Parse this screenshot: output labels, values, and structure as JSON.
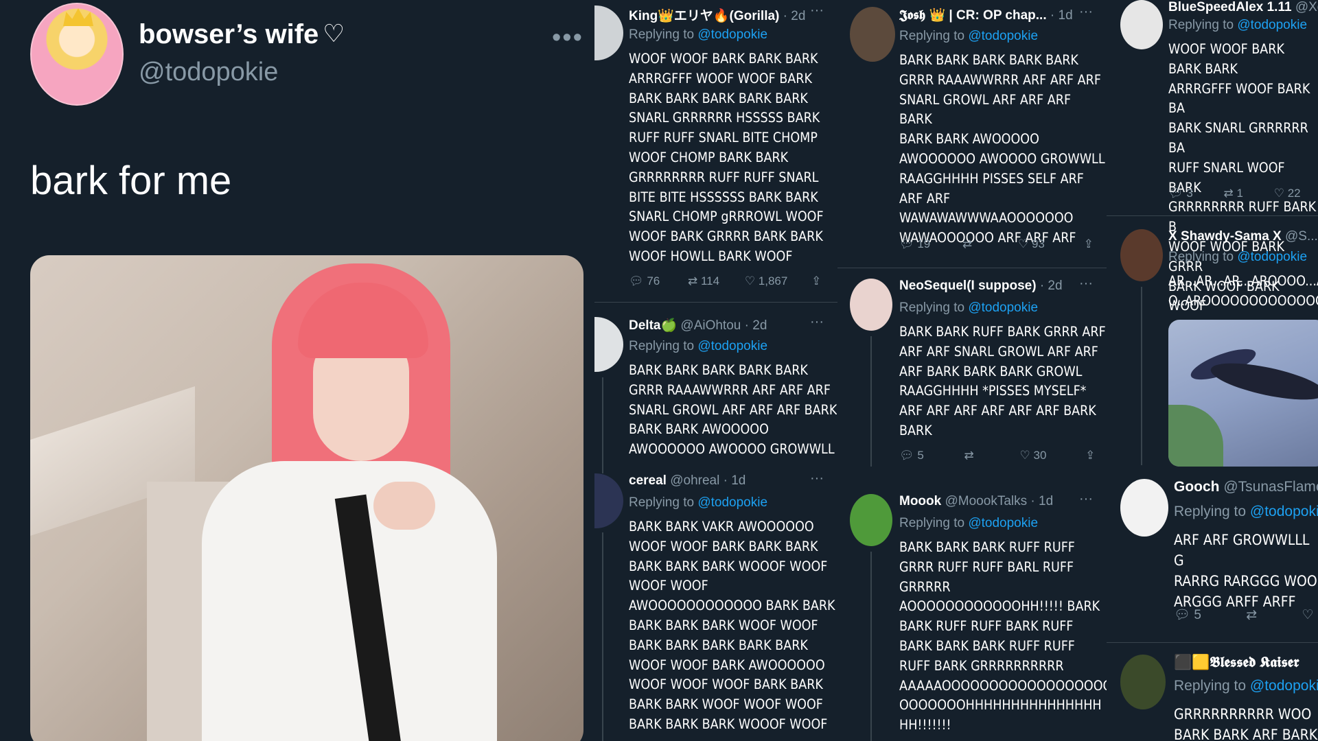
{
  "main": {
    "display_name": "bowser’s wife",
    "heart": "♡",
    "handle": "@todopokie",
    "more": "•••",
    "text": "bark for me"
  },
  "col1": {
    "r1": {
      "name": "King👑エリヤ🔥(Gorilla)",
      "handle": "",
      "time": "· 2d",
      "replying": "Replying to ",
      "mention": "@todopokie",
      "body": "WOOF WOOF BARK BARK BARK\nARRRGFFF WOOF WOOF BARK\nBARK BARK BARK BARK BARK\nSNARL GRRRRRR HSSSSS BARK\nRUFF RUFF SNARL BITE CHOMP\nWOOF CHOMP BARK BARK\nGRRRRRRRR RUFF RUFF SNARL\nBITE BITE HSSSSSS BARK BARK\nSNARL CHOMP gRRROWL WOOF\nWOOF BARK GRRRR BARK BARK\nWOOF HOWLL BARK WOOF",
      "replies": "76",
      "retweets": "114",
      "likes": "1,867"
    },
    "r2": {
      "name": "Delta🍏",
      "handle": "@AiOhtou",
      "time": "· 2d",
      "replying": "Replying to ",
      "mention": "@todopokie",
      "body": "BARK BARK BARK BARK BARK\nGRRR RAAAWWRRR ARF ARF ARF\nSNARL GROWL ARF ARF ARF BARK\nBARK BARK AWOOOOO\nAWOOOOOO AWOOOO GROWWLL\nRAAGGHHHH PISSES SELF ARF"
    },
    "r3": {
      "name": "cereal",
      "handle": "@ohreal",
      "time": "· 1d",
      "replying": "Replying to ",
      "mention": "@todopokie",
      "body": "BARK BARK VAKR AWOOOOOO\nWOOF WOOF BARK BARK BARK\nBARK BARK BARK WOOOF WOOF\nWOOF WOOF\nAWOOOOOOOOOOOO BARK BARK\nBARK BARK BARK WOOF WOOF\nBARK BARK BARK BARK BARK\nWOOF WOOF BARK AWOOOOOO\nWOOF WOOF WOOF BARK BARK\nBARK BARK WOOF WOOF WOOF\nBARK BARK BARK WOOOF WOOF"
    }
  },
  "col2": {
    "r1": {
      "name": "𝕵𝖔𝖘𝖍 👑 | CR: OP chap...",
      "handle": "",
      "time": "· 1d",
      "replying": "Replying to ",
      "mention": "@todopokie",
      "body": "BARK BARK BARK BARK BARK\nGRRR RAAAWWRRR ARF ARF ARF\nSNARL GROWL ARF ARF ARF BARK\nBARK BARK AWOOOOO\nAWOOOOOO AWOOOO GROWWLL\nRAAGGHHHH PISSES SELF ARF\nARF ARF\nWAWAWAWWWAAOOOOOOO\nWAWAOOOOOO ARF ARF ARF",
      "replies": "19",
      "likes": "93"
    },
    "r2": {
      "name": "NeoSequel(I suppose)",
      "handle": "",
      "time": "· 2d",
      "replying": "Replying to ",
      "mention": "@todopokie",
      "body": "BARK BARK RUFF BARK GRRR ARF\nARF ARF SNARL GROWL ARF ARF\nARF BARK BARK BARK  GROWL\nRAAGGHHHH *PISSES MYSELF*\nARF ARF ARF  ARF ARF ARF BARK\nBARK",
      "replies": "5",
      "likes": "30"
    },
    "r3": {
      "name": "Moook",
      "handle": "@MoookTalks",
      "time": "· 1d",
      "replying": "Replying to ",
      "mention": "@todopokie",
      "body": "BARK BARK BARK RUFF RUFF\nGRRR RUFF RUFF BARL RUFF\nGRRRRR\nAOOOOOOOOOOOOHH!!!!! BARK\nBARK RUFF RUFF BARK RUFF\nBARK BARK BARK RUFF RUFF\nRUFF BARK GRRRRRRRRRR\nAAAAAOOOOOOOOOOOOOOOOOO\nOOOOOOOHHHHHHHHHHHHHHH\nHH!!!!!!!"
    }
  },
  "col3": {
    "r1": {
      "name": "BlueSpeedAlex 1.11",
      "handle": "@Xdea",
      "time": "",
      "replying": "Replying to ",
      "mention": "@todopokie",
      "body": "WOOF WOOF BARK BARK BARK\nARRRGFFF WOOF  BARK BA\nBARK SNARL GRRRRRR BA\nRUFF SNARL WOOF BARK\nGRRRRRRRR RUFF BARK B\nWOOF WOOF BARK GRRR\nBARK WOOF BARK WOOF",
      "replies": "3",
      "retweets": "1",
      "likes": "22"
    },
    "r2": {
      "name": "X Shawdy-Sama X",
      "handle": "@S...",
      "time": "",
      "replying": "Replying to ",
      "mention": "@todopokie",
      "body": "AR...AR...AR...AROOOO...AR\nO..AROOOOOOOOOOOOOO"
    },
    "r3": {
      "name": "Gooch",
      "handle": "@TsunasFlames",
      "time": "",
      "replying": "Replying to ",
      "mention": "@todopokie",
      "body": "ARF ARF GROWWLLL G\nRARRG RARGGG WOO\nARGGG ARFF ARFF",
      "replies": "5"
    },
    "r4": {
      "name": "⬛🟨𝕭𝖑𝖊𝖘𝖘𝖊𝖉 𝕶𝖆𝖎𝖘𝖊𝖗",
      "handle": "",
      "time": "",
      "replying": "Replying to ",
      "mention": "@todopokie",
      "body": "GRRRRRRRRRR WOO\nBARK BARK ARF BARK"
    }
  }
}
